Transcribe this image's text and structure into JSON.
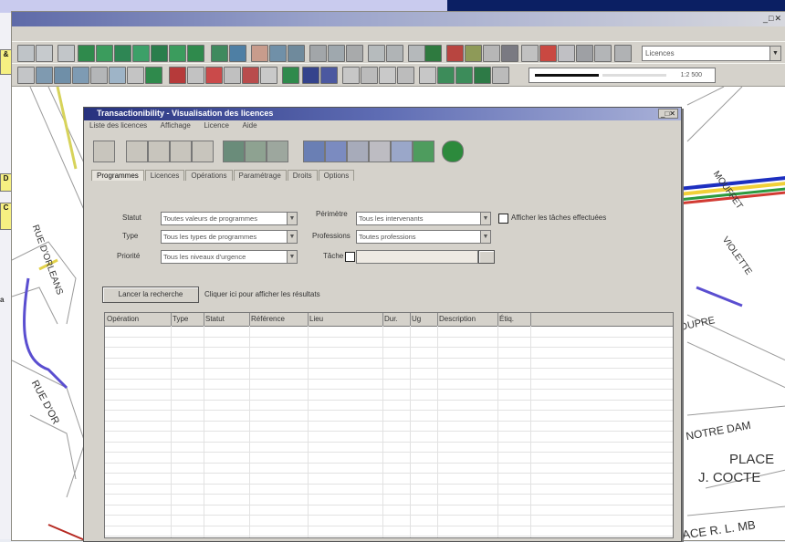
{
  "dialog": {
    "title": "Transactionibility - Visualisation des licences",
    "menu": [
      "Liste des licences",
      "Affichage",
      "Licence",
      "Aide"
    ],
    "tabs": [
      "Programmes",
      "Licences",
      "Opérations",
      "Paramétrage",
      "Droits",
      "Options"
    ],
    "active_tab": 0,
    "fields": {
      "label_1": "Statut",
      "value_1": "Toutes valeurs de programmes",
      "label_2": "Type",
      "value_2": "Tous les types de programmes",
      "label_3": "Priorité",
      "value_3": "Tous les niveaux d'urgence",
      "label_4": "Périmètre",
      "value_4": "Tous les intervenants",
      "label_5": "Professions",
      "value_5": "Toutes professions",
      "label_6": "Tâche",
      "value_6": "",
      "check_label": "Afficher les tâches effectuées"
    },
    "action_button": "Lancer la recherche",
    "action_hint": "Cliquer ici pour afficher les résultats",
    "grid_columns": [
      "Opération",
      "Type",
      "Statut",
      "Référence",
      "Lieu",
      "Dur.",
      "Ug",
      "Description",
      "Étiq."
    ]
  },
  "toolbar": {
    "layer_combo": "Licences",
    "scale_value": "1:2 500"
  },
  "map_labels": [
    "RUE D'ORLEANS",
    "MOUFFET",
    "RUE D'OR",
    "VIOLETTE",
    "DUPRE",
    "NOTRE DAM",
    "PLACE",
    "J. COCTE",
    "ACE R. L. MB"
  ],
  "left_panel": [
    "&",
    "D",
    "C",
    "a"
  ]
}
